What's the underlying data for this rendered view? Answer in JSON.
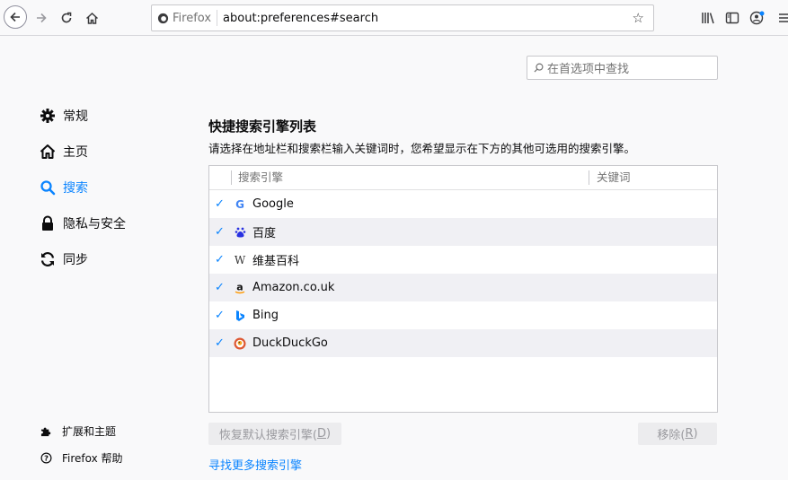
{
  "toolbar": {
    "identity_label": "Firefox",
    "url": "about:preferences#search"
  },
  "find": {
    "placeholder": "在首选项中查找"
  },
  "sidebar": {
    "categories": [
      {
        "label": "常规",
        "icon": "gear-icon"
      },
      {
        "label": "主页",
        "icon": "home-icon"
      },
      {
        "label": "搜索",
        "icon": "search-icon",
        "selected": true
      },
      {
        "label": "隐私与安全",
        "icon": "lock-icon"
      },
      {
        "label": "同步",
        "icon": "sync-icon"
      }
    ],
    "footer": [
      {
        "label": "扩展和主题",
        "icon": "puzzle-icon"
      },
      {
        "label": "Firefox 帮助",
        "icon": "help-icon"
      }
    ]
  },
  "main": {
    "heading": "快捷搜索引擎列表",
    "description": "请选择在地址栏和搜索栏输入关键词时，您希望显示在下方的其他可选用的搜索引擎。",
    "columns": {
      "engine": "搜索引擎",
      "keyword": "关键词"
    },
    "engines": [
      {
        "name": "Google",
        "checked": true,
        "icon_glyph": "G",
        "icon_color": "#4285f4"
      },
      {
        "name": "百度",
        "checked": true,
        "icon_glyph": "ꙮ",
        "icon_color": "#2932e1"
      },
      {
        "name": "维基百科",
        "checked": true,
        "icon_glyph": "W",
        "icon_color": "#333333"
      },
      {
        "name": "Amazon.co.uk",
        "checked": true,
        "icon_glyph": "a",
        "icon_color": "#ff9900"
      },
      {
        "name": "Bing",
        "checked": true,
        "icon_glyph": "b",
        "icon_color": "#0a84ff"
      },
      {
        "name": "DuckDuckGo",
        "checked": true,
        "icon_glyph": "◉",
        "icon_color": "#de5833"
      }
    ],
    "restore_label": "恢复默认搜索引擎(",
    "restore_key": "D",
    "remove_label": "移除(",
    "remove_key": "R",
    "more_link": "寻找更多搜索引擎"
  },
  "colors": {
    "accent": "#0a84ff",
    "alt_row": "#f0f0f4"
  }
}
